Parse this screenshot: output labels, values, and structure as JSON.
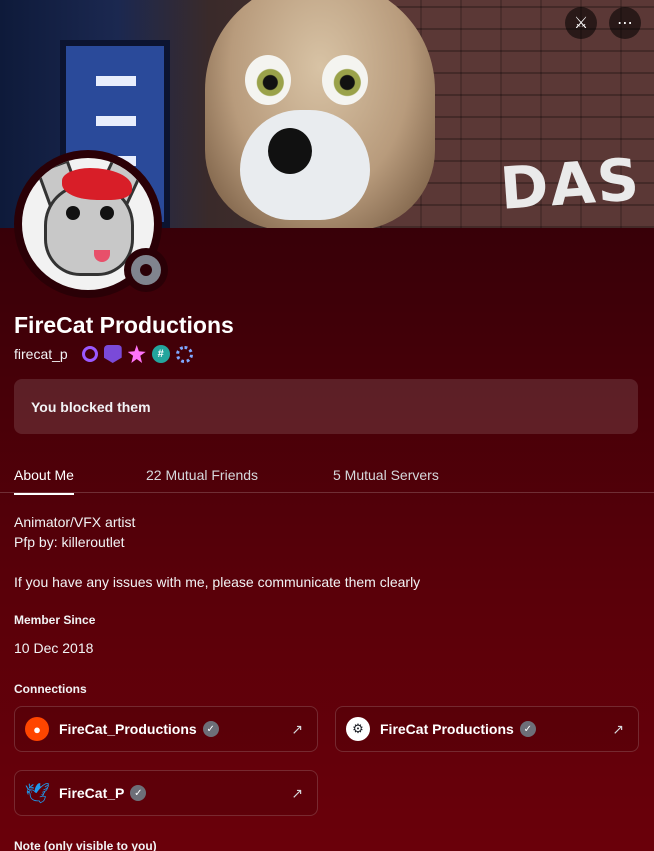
{
  "banner": {
    "sign_text": "DAS",
    "buttons": [
      {
        "icon": "game-controller-icon",
        "glyph": "⚔"
      },
      {
        "icon": "more-icon",
        "glyph": "⋯"
      }
    ]
  },
  "profile": {
    "display_name": "FireCat Productions",
    "username": "firecat_p",
    "status": "offline",
    "badges": [
      "nitro-badge",
      "hypesquad-badge",
      "boost-badge",
      "completed-quest-badge",
      "active-developer-badge"
    ],
    "blocked_text": "You blocked them"
  },
  "tabs": [
    {
      "label": "About Me",
      "active": true
    },
    {
      "label": "22 Mutual Friends",
      "active": false
    },
    {
      "label": "5 Mutual Servers",
      "active": false
    }
  ],
  "about": {
    "bio_lines": [
      "Animator/VFX artist",
      "Pfp by: killeroutlet",
      "",
      "If you have any issues with me, please communicate them clearly"
    ],
    "member_since_title": "Member Since",
    "member_since_value": "10 Dec 2018",
    "connections_title": "Connections",
    "note_title": "Note (only visible to you)"
  },
  "connections": [
    {
      "service": "reddit",
      "icon": "reddit-icon",
      "name": "FireCat_Productions",
      "verified": true
    },
    {
      "service": "steam",
      "icon": "steam-icon",
      "name": "FireCat Productions",
      "verified": true
    },
    {
      "service": "twitter",
      "icon": "twitter-icon",
      "name": "FireCat_P",
      "verified": true
    }
  ],
  "colors": {
    "background_top": "#2a0006",
    "background_bottom": "#6a000a",
    "twitter_blue": "#1d9bf0",
    "reddit_orange": "#ff4500"
  }
}
